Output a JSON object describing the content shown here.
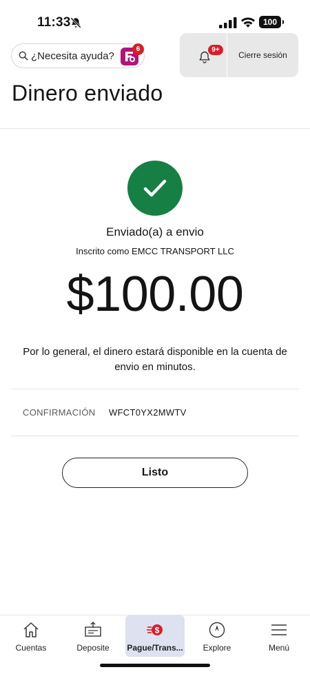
{
  "status_bar": {
    "time": "11:33",
    "battery": "100",
    "icons": [
      "bell-slash-icon",
      "signal-icon",
      "wifi-icon",
      "battery-icon"
    ]
  },
  "header": {
    "help_text": "¿Necesita ayuda?",
    "assistant_badge": "6",
    "notifications_badge": "9+",
    "logout_label": "Cierre sesión",
    "page_title": "Dinero enviado"
  },
  "confirmation": {
    "sent_to": "Enviado(a) a envio",
    "enrolled_as": "Inscrito como EMCC TRANSPORT LLC",
    "amount": "$100.00",
    "availability": "Por lo general, el dinero estará disponible en la cuenta de envio en minutos.",
    "conf_label": "CONFIRMACIÓN",
    "conf_value": "WFCT0YX2MWTV",
    "done_label": "Listo"
  },
  "nav": {
    "items": [
      {
        "label": "Cuentas",
        "icon": "home-icon"
      },
      {
        "label": "Deposite",
        "icon": "deposit-icon"
      },
      {
        "label": "Pague/Trans...",
        "icon": "pay-transfer-icon",
        "active": true
      },
      {
        "label": "Explore",
        "icon": "compass-icon"
      },
      {
        "label": "Menú",
        "icon": "menu-icon"
      }
    ]
  },
  "colors": {
    "success_green": "#168044",
    "badge_red": "#d71e28",
    "active_nav_bg": "#dde1f0"
  }
}
